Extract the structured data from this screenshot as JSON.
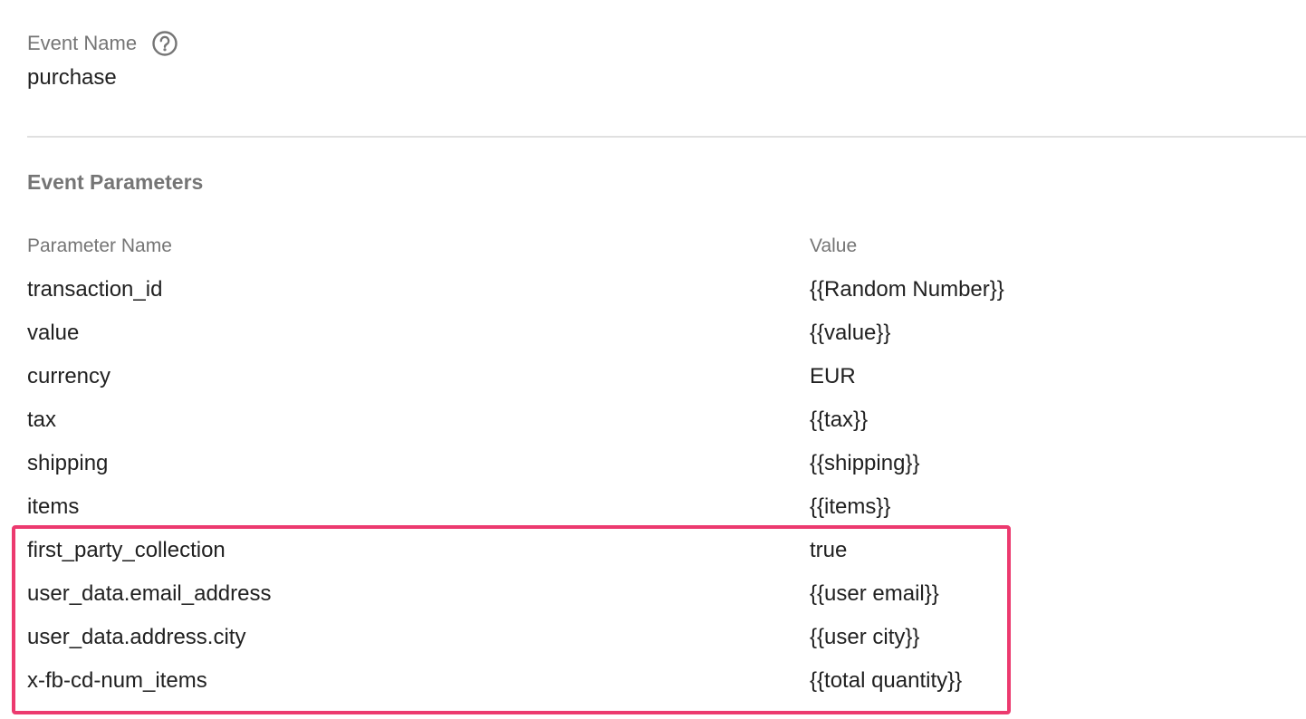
{
  "event_name": {
    "label": "Event Name",
    "help_icon": "help-circle-icon",
    "value": "purchase"
  },
  "event_parameters": {
    "title": "Event Parameters",
    "columns": {
      "name": "Parameter Name",
      "value": "Value"
    },
    "rows": [
      {
        "name": "transaction_id",
        "value": "{{Random Number}}"
      },
      {
        "name": "value",
        "value": "{{value}}"
      },
      {
        "name": "currency",
        "value": "EUR"
      },
      {
        "name": "tax",
        "value": "{{tax}}"
      },
      {
        "name": "shipping",
        "value": "{{shipping}}"
      },
      {
        "name": "items",
        "value": "{{items}}"
      },
      {
        "name": "first_party_collection",
        "value": "true"
      },
      {
        "name": "user_data.email_address",
        "value": "{{user email}}"
      },
      {
        "name": "user_data.address.city",
        "value": "{{user city}}"
      },
      {
        "name": "x-fb-cd-num_items",
        "value": "{{total quantity}}"
      }
    ]
  },
  "highlight": {
    "color": "#ec3a6f"
  }
}
